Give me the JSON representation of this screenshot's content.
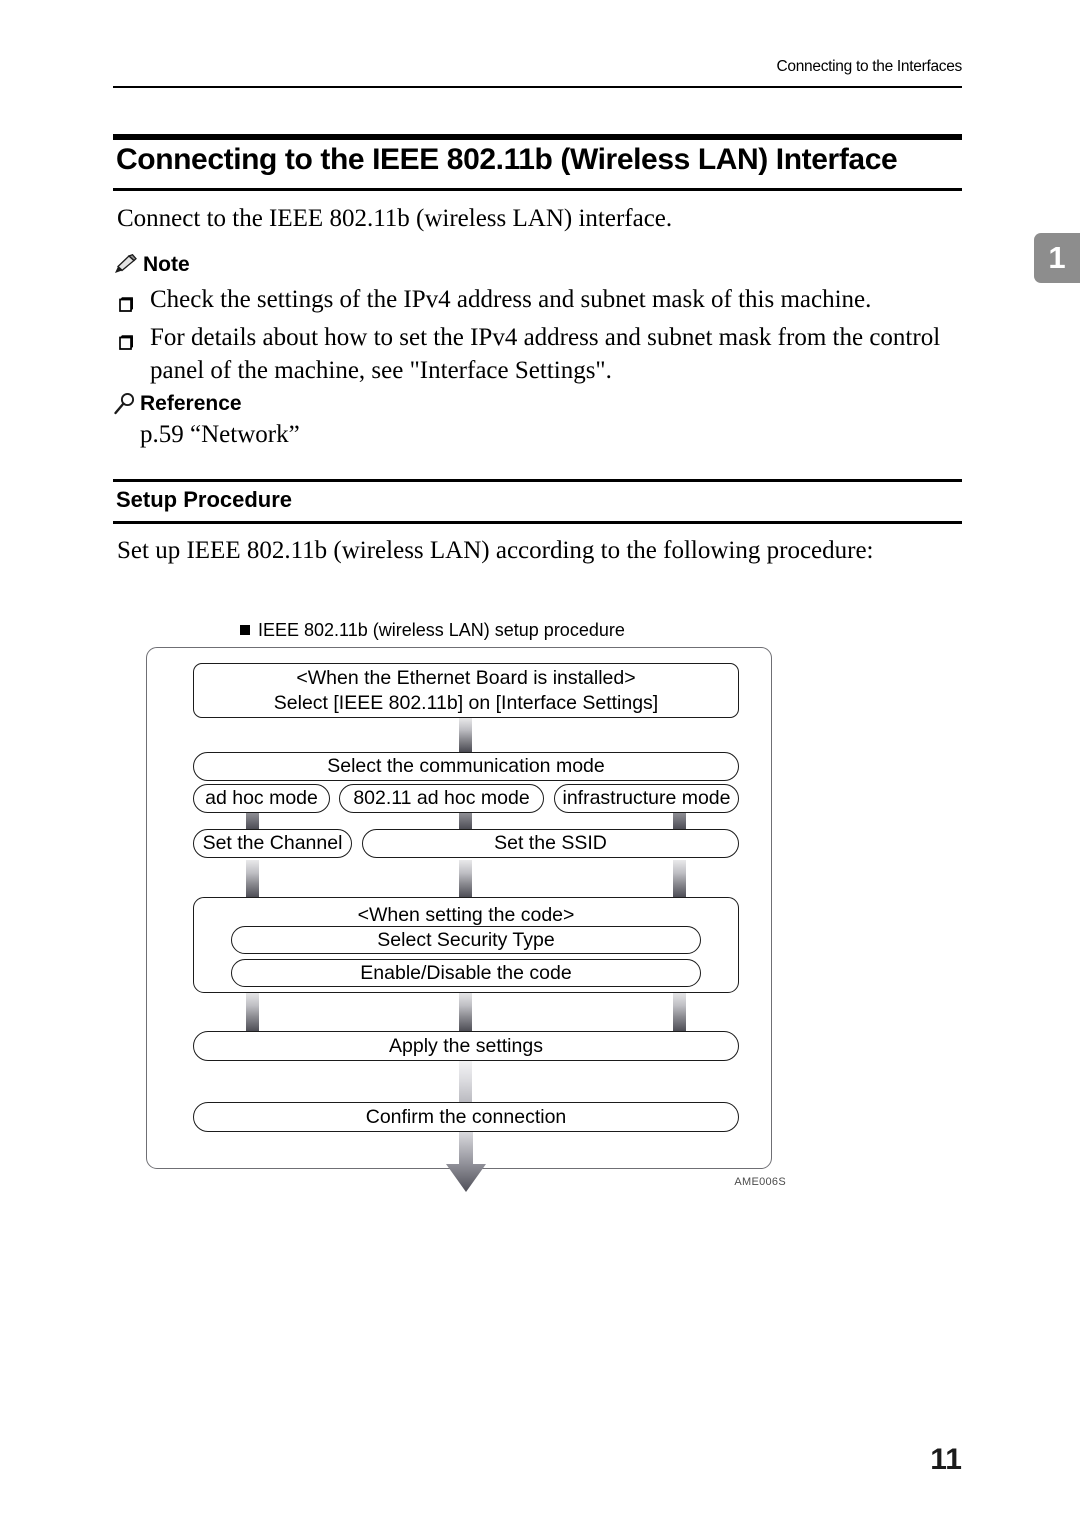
{
  "header": {
    "running_head": "Connecting to the Interfaces",
    "chapter_tab": "1"
  },
  "title": "Connecting to the IEEE 802.11b (Wireless LAN) Interface",
  "intro_paragraph": "Connect to the IEEE 802.11b (wireless LAN) interface.",
  "note": {
    "heading": "Note",
    "icon": "pencil-icon",
    "items": [
      "Check the settings of the IPv4 address and subnet mask of this machine.",
      "For details about how to set the IPv4 address and subnet mask from the control panel of the machine, see \"Interface Settings\"."
    ]
  },
  "reference": {
    "heading": "Reference",
    "icon": "magnifier-icon",
    "body": "p.59 “Network”"
  },
  "setup": {
    "heading": "Setup Procedure",
    "paragraph": "Set up IEEE 802.11b (wireless LAN) according to the following procedure:"
  },
  "figure": {
    "caption": "IEEE 802.11b (wireless LAN) setup procedure",
    "figure_id": "AME006S",
    "steps": {
      "step1_line1": "<When the Ethernet Board is installed>",
      "step1_line2": "Select [IEEE 802.11b] on [Interface Settings]",
      "step2": "Select the communication mode",
      "mode_adhoc": "ad hoc mode",
      "mode_80211_adhoc": "802.11 ad hoc mode",
      "mode_infrastructure": "infrastructure mode",
      "set_channel": "Set the Channel",
      "set_ssid": "Set the SSID",
      "code_group_title": "<When setting the code>",
      "select_security_type": "Select Security Type",
      "enable_disable_code": "Enable/Disable the code",
      "apply_settings": "Apply the settings",
      "confirm_connection": "Confirm the connection"
    }
  },
  "folio": "11"
}
